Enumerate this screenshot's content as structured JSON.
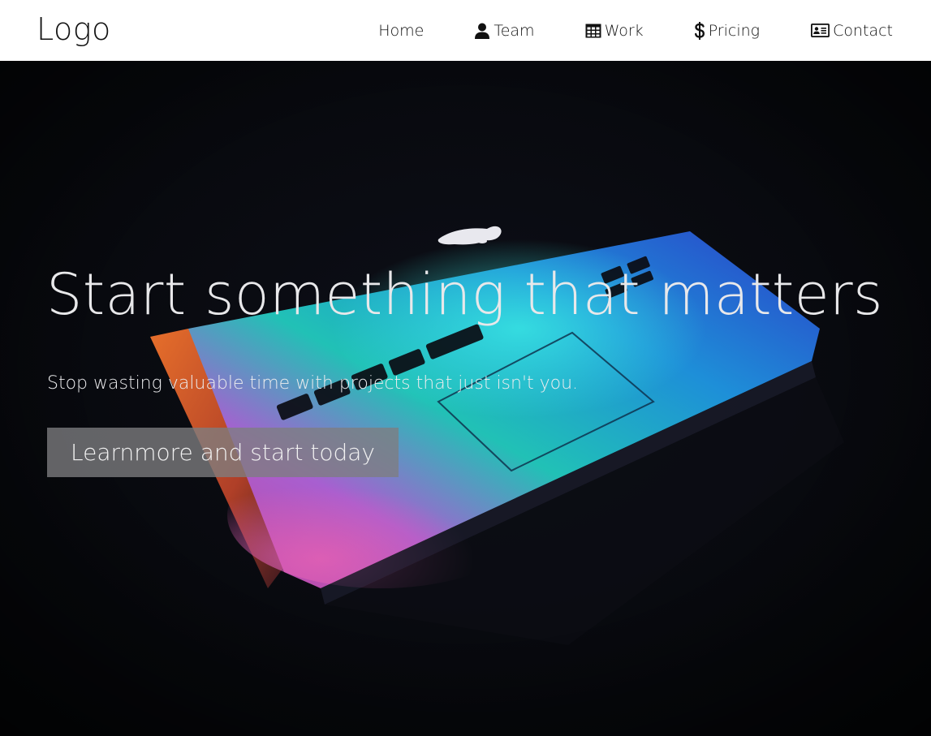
{
  "header": {
    "logo": "Logo",
    "nav": [
      {
        "label": "Home",
        "icon": ""
      },
      {
        "label": "Team",
        "icon": "user-icon"
      },
      {
        "label": "Work",
        "icon": "table-icon"
      },
      {
        "label": "Pricing",
        "icon": "dollar-icon"
      },
      {
        "label": "Contact",
        "icon": "address-card-icon"
      }
    ]
  },
  "hero": {
    "title": "Start something that matters",
    "subtitle": "Stop wasting valuable time with projects that just isn't you.",
    "cta_label": "Learnmore and start today"
  },
  "colors": {
    "header_bg": "#ffffff",
    "hero_bg": "#07080c",
    "text_light": "#e8e8ea",
    "button_bg": "#7d7d80"
  }
}
